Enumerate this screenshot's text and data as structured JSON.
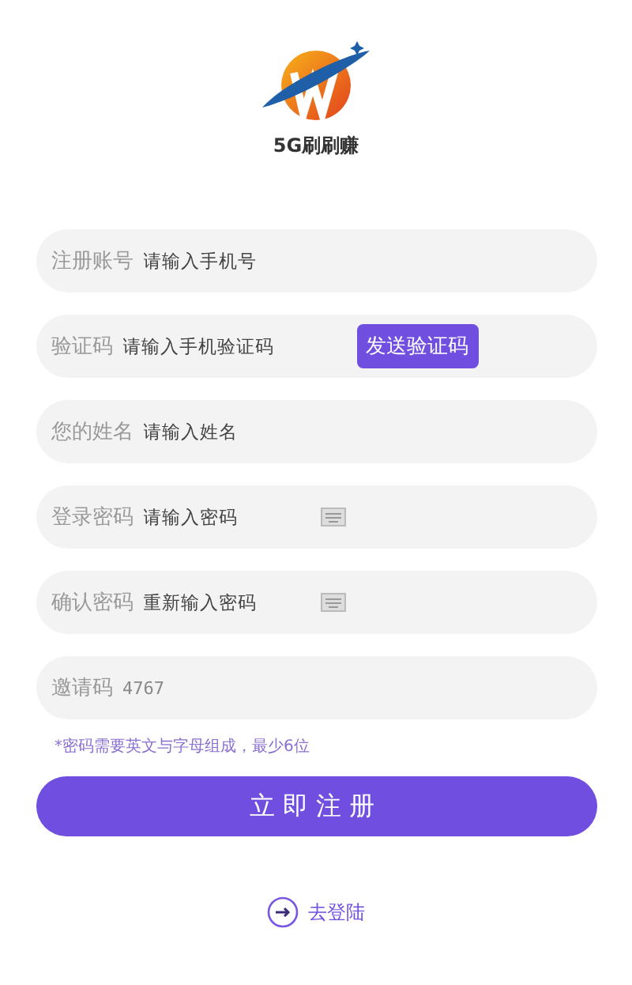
{
  "logo": {
    "text": "5G刷刷赚"
  },
  "fields": [
    {
      "kind": "text",
      "label": "注册账号",
      "placeholder": "请输入手机号"
    },
    {
      "kind": "code",
      "label": "验证码",
      "placeholder": "请输入手机验证码",
      "action": "发送验证码"
    },
    {
      "kind": "text",
      "label": "您的姓名",
      "placeholder": "请输入姓名"
    },
    {
      "kind": "password",
      "label": "登录密码",
      "placeholder": "请输入密码"
    },
    {
      "kind": "password",
      "label": "确认密码",
      "placeholder": "重新输入密码"
    },
    {
      "kind": "text",
      "label": "邀请码",
      "value": "4767"
    }
  ],
  "hint": "*密码需要英文与字母组成，最少6位",
  "submit": "立即注册",
  "login_link": "去登陆"
}
